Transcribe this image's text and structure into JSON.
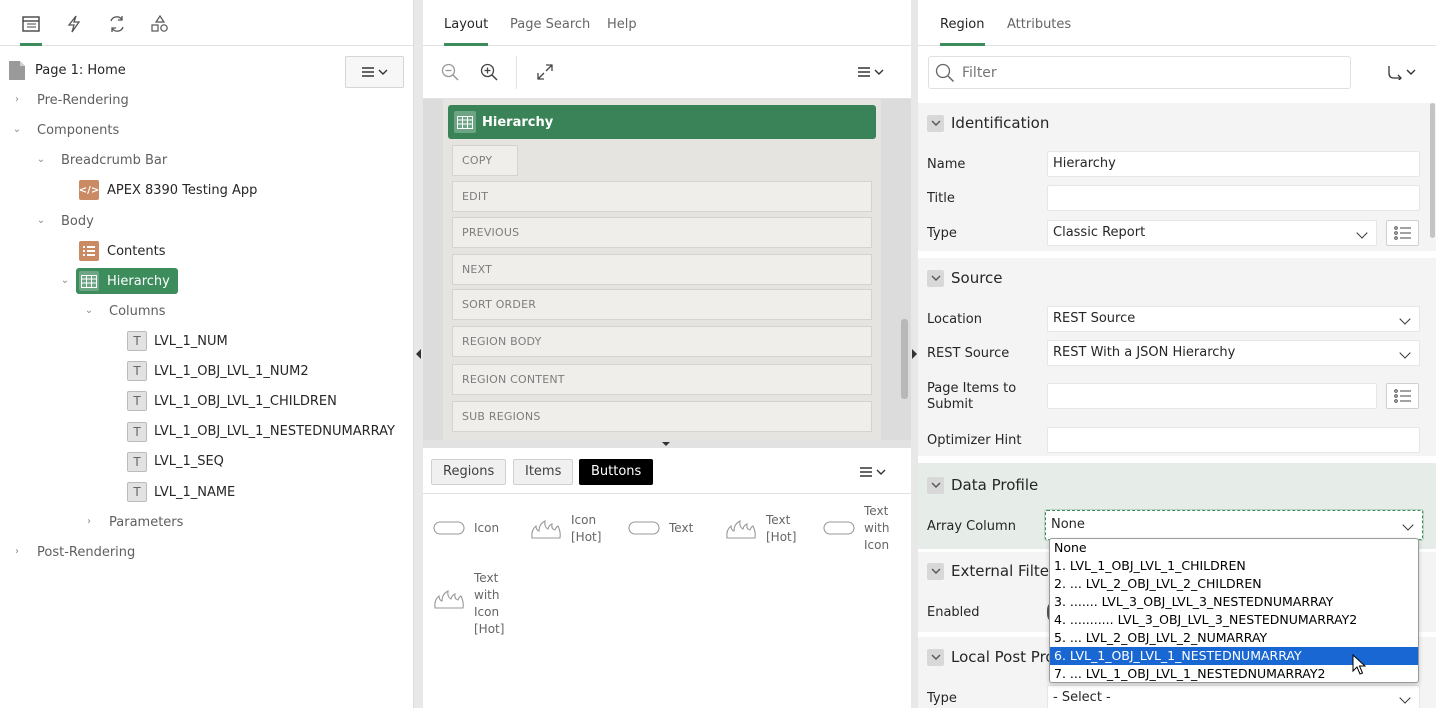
{
  "left_panel": {
    "toolbar_icons": [
      "rendering-tree-icon",
      "dynamic-actions-icon",
      "processing-icon",
      "shared-components-icon"
    ],
    "page_title": "Page 1: Home",
    "tree": {
      "pre_rendering": "Pre-Rendering",
      "components": "Components",
      "breadcrumb_bar": "Breadcrumb Bar",
      "breadcrumb_region": "APEX 8390 Testing App",
      "body": "Body",
      "contents": "Contents",
      "hierarchy": "Hierarchy",
      "columns": "Columns",
      "column_items": [
        "LVL_1_NUM",
        "LVL_1_OBJ_LVL_1_NUM2",
        "LVL_1_OBJ_LVL_1_CHILDREN",
        "LVL_1_OBJ_LVL_1_NESTEDNUMARRAY",
        "LVL_1_SEQ",
        "LVL_1_NAME"
      ],
      "parameters": "Parameters",
      "post_rendering": "Post-Rendering"
    }
  },
  "middle_panel": {
    "tabs": [
      "Layout",
      "Page Search",
      "Help"
    ],
    "region_title": "Hierarchy",
    "drop_zones": [
      "COPY",
      "EDIT",
      "PREVIOUS",
      "NEXT",
      "SORT ORDER",
      "REGION BODY",
      "REGION CONTENT",
      "SUB REGIONS"
    ],
    "gallery_tabs": [
      "Regions",
      "Items",
      "Buttons"
    ],
    "gallery_items": [
      {
        "label": "Icon"
      },
      {
        "label": "Icon [Hot]"
      },
      {
        "label": "Text"
      },
      {
        "label": "Text [Hot]"
      },
      {
        "label": "Text with Icon"
      },
      {
        "label": "Text with Icon [Hot]"
      }
    ]
  },
  "right_panel": {
    "tabs": [
      "Region",
      "Attributes"
    ],
    "filter_placeholder": "Filter",
    "sections": {
      "identification": "Identification",
      "source": "Source",
      "data_profile": "Data Profile",
      "external_filter": "External Filter",
      "local_post": "Local Post Pro"
    },
    "props": {
      "name_label": "Name",
      "name_value": "Hierarchy",
      "title_label": "Title",
      "title_value": "",
      "type_label": "Type",
      "type_value": "Classic Report",
      "location_label": "Location",
      "location_value": "REST Source",
      "rest_source_label": "REST Source",
      "rest_source_value": "REST With a JSON Hierarchy",
      "page_items_label": "Page Items to Submit",
      "optimizer_label": "Optimizer Hint",
      "array_column_label": "Array Column",
      "array_column_value": "None",
      "enabled_label": "Enabled",
      "type2_label": "Type",
      "type2_value": "- Select -"
    },
    "dropdown_options": [
      "None",
      "1. LVL_1_OBJ_LVL_1_CHILDREN",
      "2. ... LVL_2_OBJ_LVL_2_CHILDREN",
      "3. ....... LVL_3_OBJ_LVL_3_NESTEDNUMARRAY",
      "4. ........... LVL_3_OBJ_LVL_3_NESTEDNUMARRAY2",
      "5. ... LVL_2_OBJ_LVL_2_NUMARRAY",
      "6. LVL_1_OBJ_LVL_1_NESTEDNUMARRAY",
      "7. ... LVL_1_OBJ_LVL_1_NESTEDNUMARRAY2"
    ],
    "dropdown_highlighted": "6. LVL_1_OBJ_LVL_1_NESTEDNUMARRAY"
  },
  "colors": {
    "accent": "#3c8c5c",
    "region_header": "#3a8257",
    "highlight": "#1967d2",
    "breadcrumb_icon": "#c98a64"
  }
}
